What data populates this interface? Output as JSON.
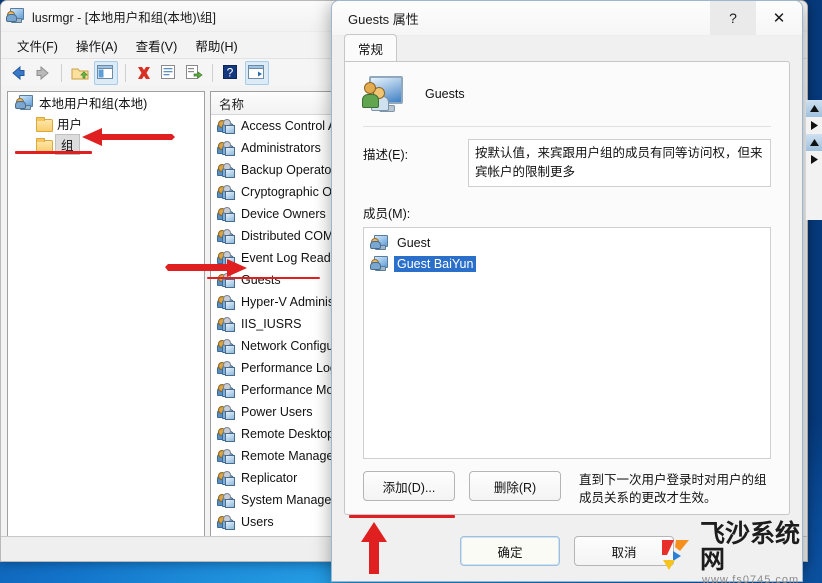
{
  "window": {
    "title": "lusrmgr - [本地用户和组(本地)\\组]",
    "icon": "computer-users-icon",
    "menus": [
      "文件(F)",
      "操作(A)",
      "查看(V)",
      "帮助(H)"
    ],
    "toolbar_icons": [
      "back-arrow-icon",
      "forward-arrow-icon",
      "separator",
      "up-folder-icon",
      "show-hide-tree-icon",
      "separator",
      "delete-x-icon",
      "properties-icon",
      "export-list-icon",
      "separator",
      "help-icon",
      "show-action-pane-icon"
    ]
  },
  "tree": {
    "root": "本地用户和组(本地)",
    "items": [
      {
        "label": "用户",
        "icon": "folder-icon",
        "selected": false
      },
      {
        "label": "组",
        "icon": "folder-icon",
        "selected": true
      }
    ]
  },
  "list": {
    "column_header": "名称",
    "rows": [
      {
        "name": "Access Control As"
      },
      {
        "name": "Administrators"
      },
      {
        "name": "Backup Operators"
      },
      {
        "name": "Cryptographic Op"
      },
      {
        "name": "Device Owners"
      },
      {
        "name": "Distributed COM U"
      },
      {
        "name": "Event Log Readers"
      },
      {
        "name": "Guests"
      },
      {
        "name": "Hyper-V Administr"
      },
      {
        "name": "IIS_IUSRS"
      },
      {
        "name": "Network Configura"
      },
      {
        "name": "Performance Log "
      },
      {
        "name": "Performance Mon"
      },
      {
        "name": "Power Users"
      },
      {
        "name": "Remote Desktop U"
      },
      {
        "name": "Remote Managem"
      },
      {
        "name": "Replicator"
      },
      {
        "name": "System Managed "
      },
      {
        "name": "Users"
      }
    ],
    "highlighted_row_index": 7
  },
  "dialog": {
    "title": "Guests 属性",
    "help_button": "?",
    "close_button": "✕",
    "tabs": [
      {
        "label": "常规",
        "active": true
      }
    ],
    "group_name": "Guests",
    "group_icon": "group-computer-icon",
    "description_label": "描述(E):",
    "description_value": "按默认值，来宾跟用户组的成员有同等访问权，但来宾帐户的限制更多",
    "members_label": "成员(M):",
    "members": [
      {
        "name": "Guest",
        "selected": false
      },
      {
        "name": "Guest BaiYun",
        "selected": true
      }
    ],
    "add_button": "添加(D)...",
    "remove_button": "删除(R)",
    "hint": "直到下一次用户登录时对用户的组成员关系的更改才生效。",
    "ok_button": "确定",
    "cancel_button": "取消"
  },
  "annotations": {
    "arrow_tree_group": "red-arrow-pointing-to-group-node",
    "underline_tree_group": "red-underline",
    "arrow_list_guests": "red-arrow-pointing-to-guests",
    "underline_list_guests": "red-underline",
    "arrow_add_button": "red-arrow-pointing-up-to-add-button",
    "underline_add_button": "red-underline",
    "accent_color": "#e02020"
  },
  "watermark": {
    "text": "飞沙系统网",
    "url": "www.fs0745.com",
    "colors": {
      "red": "#e8302a",
      "orange": "#f5901e",
      "blue": "#2b7fd4",
      "yellow": "#f5c21e"
    }
  },
  "scrollbars": {
    "list_vertical": "vertical-scrollbar",
    "edge_buttons": [
      "scroll-up-button",
      "scroll-right-button",
      "scroll-up-button-2",
      "scroll-right-button-2"
    ]
  }
}
